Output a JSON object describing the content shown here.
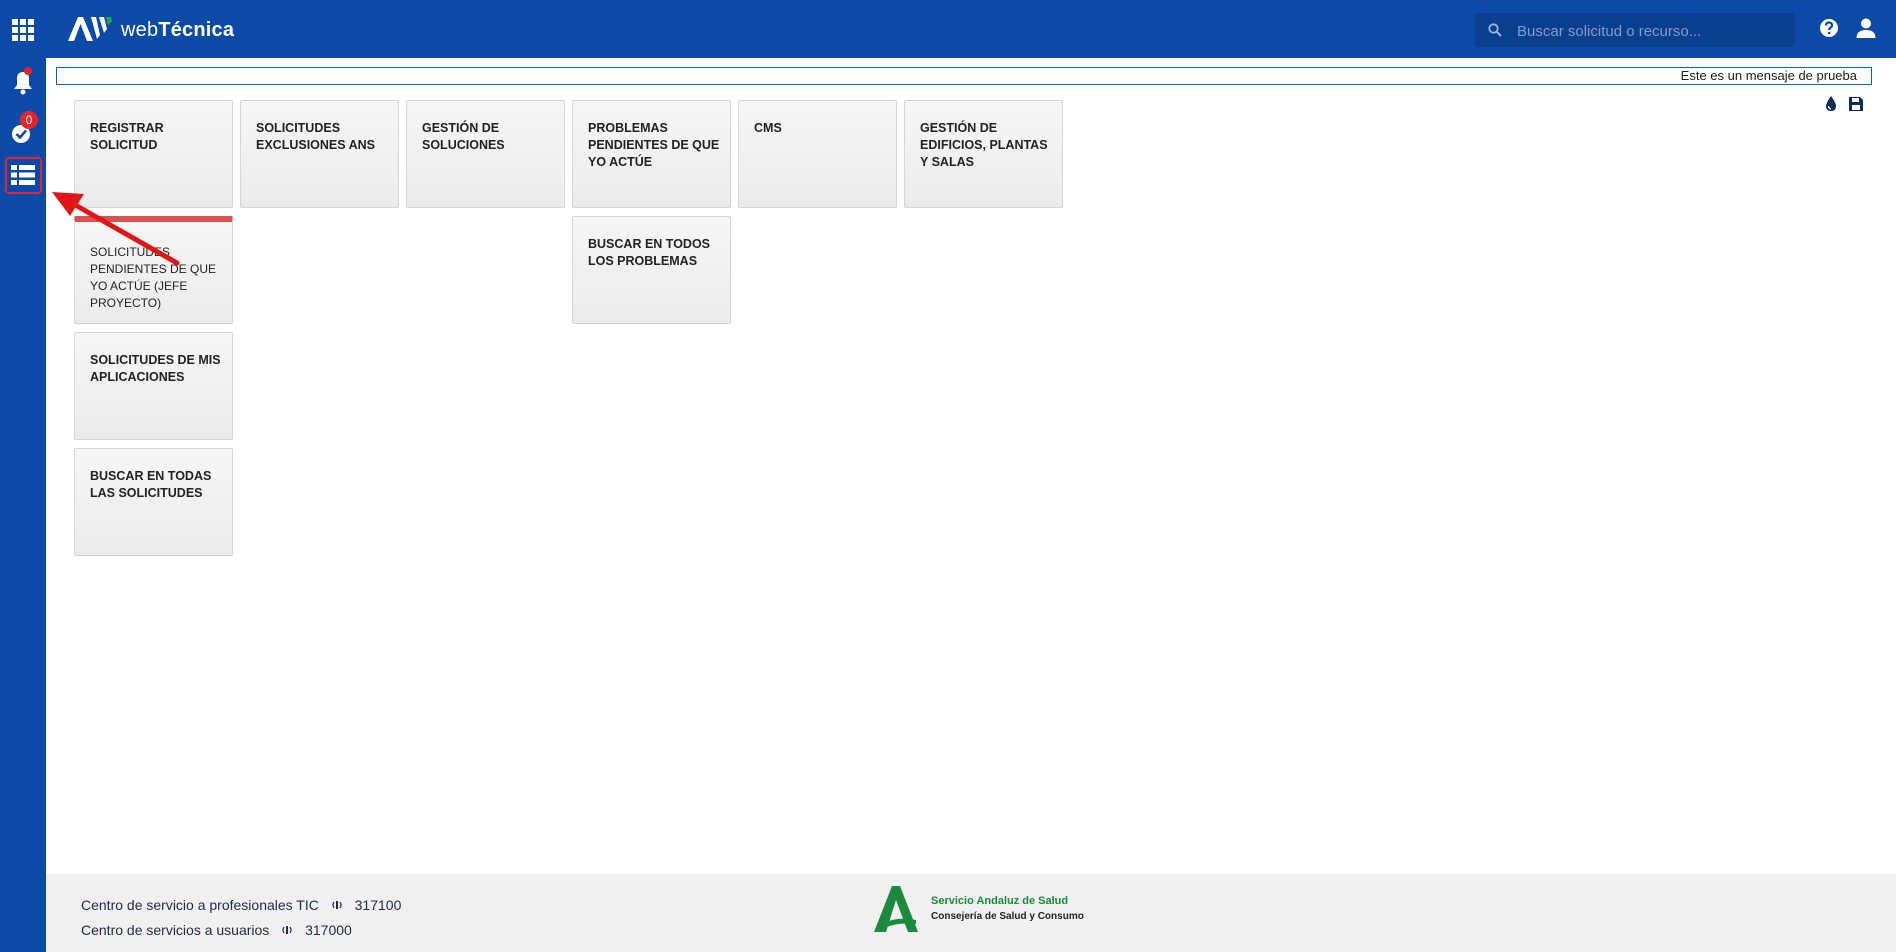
{
  "header": {
    "apps_icon": "grid-icon",
    "brand_prefix": "web",
    "brand_bold": "Técnica",
    "search_placeholder": "Buscar solicitud o recurso...",
    "accent_color": "#0b4aa8"
  },
  "rail": {
    "notifications": {
      "icon": "bell-icon"
    },
    "tasks": {
      "icon": "check-badge-icon",
      "count": "0"
    },
    "menu": {
      "icon": "list-icon"
    }
  },
  "message": {
    "text": "Este es un mensaje de prueba"
  },
  "tiles": [
    "REGISTRAR SOLICITUD",
    "SOLICITUDES EXCLUSIONES ANS",
    "GESTIÓN DE SOLUCIONES",
    "PROBLEMAS PENDIENTES DE QUE YO ACTÚE",
    "CMS",
    "GESTIÓN DE EDIFICIOS, PLANTAS Y SALAS",
    "SOLICITUDES PENDIENTES DE QUE YO ACTÚE (JEFE PROYECTO)",
    "BUSCAR EN TODOS LOS PROBLEMAS",
    "SOLICITUDES DE MIS APLICACIONES",
    "BUSCAR EN TODAS LAS SOLICITUDES"
  ],
  "footer": {
    "line1_label": "Centro de servicio a profesionales TIC",
    "line1_phone": "317100",
    "line2_label": "Centro de servicios a usuarios",
    "line2_phone": "317000",
    "org_name": "Servicio Andaluz de Salud",
    "org_sub": "Consejería de Salud y Consumo"
  }
}
